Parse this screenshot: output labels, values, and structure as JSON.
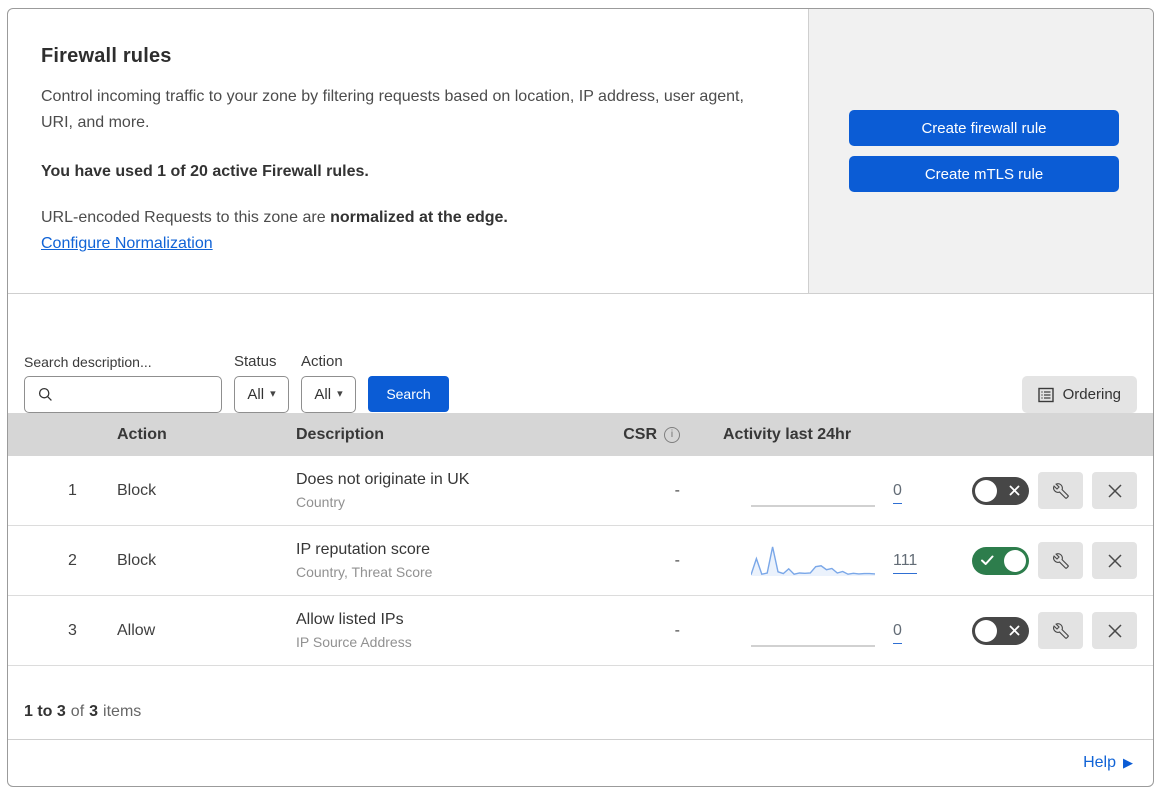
{
  "colors": {
    "primary_button": "#0b5cd5",
    "link": "#1063d6",
    "toggle_on": "#2d7d4c",
    "toggle_off": "#474747",
    "spark_active": "#7aa7e8",
    "spark_flat": "#c2c2c2",
    "table_header_bg": "#d6d6d6",
    "side_panel_bg": "#f1f1f1"
  },
  "header": {
    "title": "Firewall rules",
    "description": "Control incoming traffic to your zone by filtering requests based on location, IP address, user agent, URI, and more.",
    "usage": "You have used 1 of 20 active Firewall rules.",
    "normalization_text": "URL-encoded Requests to this zone are",
    "normalization_bold": "normalized at the edge.",
    "normalization_link": "Configure Normalization",
    "create_firewall_rule": "Create firewall rule",
    "create_mtls_rule": "Create mTLS rule"
  },
  "filters": {
    "search_label": "Search description...",
    "status_label": "Status",
    "status_value": "All",
    "action_label": "Action",
    "action_value": "All",
    "search_button": "Search",
    "ordering_button": "Ordering"
  },
  "table": {
    "headers": {
      "action": "Action",
      "description": "Description",
      "csr": "CSR",
      "activity": "Activity last 24hr"
    },
    "rows": [
      {
        "index": "1",
        "action": "Block",
        "description": "Does not originate in UK",
        "fields": "Country",
        "csr": "-",
        "activity_count": "0",
        "enabled": false,
        "activity_series": [
          0,
          0,
          0,
          0,
          0,
          0,
          0,
          0,
          0,
          0,
          0,
          0,
          0,
          0,
          0,
          0,
          0,
          0,
          0,
          0,
          0,
          0,
          0,
          0
        ]
      },
      {
        "index": "2",
        "action": "Block",
        "description": "IP reputation score",
        "fields": "Country, Threat Score",
        "csr": "-",
        "activity_count": "111",
        "enabled": true,
        "activity_series": [
          4,
          58,
          6,
          10,
          97,
          14,
          8,
          24,
          6,
          10,
          9,
          10,
          31,
          34,
          21,
          25,
          10,
          15,
          6,
          9,
          7,
          8,
          8,
          7
        ]
      },
      {
        "index": "3",
        "action": "Allow",
        "description": "Allow listed IPs",
        "fields": "IP Source Address",
        "csr": "-",
        "activity_count": "0",
        "enabled": false,
        "activity_series": [
          0,
          0,
          0,
          0,
          0,
          0,
          0,
          0,
          0,
          0,
          0,
          0,
          0,
          0,
          0,
          0,
          0,
          0,
          0,
          0,
          0,
          0,
          0,
          0
        ]
      }
    ]
  },
  "footer": {
    "range": "1 to 3",
    "of": "of",
    "total": "3",
    "items": "items"
  },
  "help": {
    "label": "Help"
  }
}
